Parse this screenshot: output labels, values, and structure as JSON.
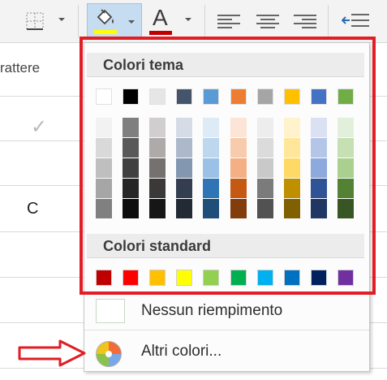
{
  "column_header": {
    "text": "rattere"
  },
  "cells": {
    "check": "✓",
    "c": "C"
  },
  "toolbar": {
    "fill_icon": "paint-bucket-icon",
    "fill_color": "#ffff00",
    "font_color_icon": "font-color-icon",
    "font_color_letter": "A",
    "font_color": "#c00000"
  },
  "dropdown": {
    "theme_header": "Colori tema",
    "standard_header": "Colori standard",
    "theme_colors": [
      "#ffffff",
      "#000000",
      "#e7e6e6",
      "#44546a",
      "#5b9bd5",
      "#ed7d31",
      "#a5a5a5",
      "#ffc000",
      "#4472c4",
      "#70ad47"
    ],
    "theme_shades": [
      [
        "#f2f2f2",
        "#d9d9d9",
        "#bfbfbf",
        "#a6a6a6",
        "#808080"
      ],
      [
        "#7f7f7f",
        "#595959",
        "#404040",
        "#262626",
        "#0d0d0d"
      ],
      [
        "#d0cece",
        "#aeaaaa",
        "#757171",
        "#3b3838",
        "#171616"
      ],
      [
        "#d6dce5",
        "#adb9ca",
        "#8497b0",
        "#333f50",
        "#222a35"
      ],
      [
        "#ddebf7",
        "#bdd7ee",
        "#9bc2e6",
        "#2f75b5",
        "#1f4e79"
      ],
      [
        "#fce4d6",
        "#f8cbad",
        "#f4b084",
        "#c65911",
        "#833c0b"
      ],
      [
        "#ededed",
        "#dbdbdb",
        "#c9c9c9",
        "#7b7b7b",
        "#525252"
      ],
      [
        "#fff2cc",
        "#ffe699",
        "#ffd966",
        "#bf8f00",
        "#806000"
      ],
      [
        "#d9e1f2",
        "#b4c6e7",
        "#8ea9db",
        "#2f5496",
        "#203764"
      ],
      [
        "#e2efda",
        "#c6e0b4",
        "#a9d08e",
        "#548235",
        "#375623"
      ]
    ],
    "standard_colors": [
      "#c00000",
      "#ff0000",
      "#ffc000",
      "#ffff00",
      "#92d050",
      "#00b050",
      "#00b0f0",
      "#0070c0",
      "#002060",
      "#7030a0"
    ],
    "no_fill_label": "Nessun riempimento",
    "more_colors_label": "Altri colori...",
    "highlight_color": "#e01e26"
  }
}
